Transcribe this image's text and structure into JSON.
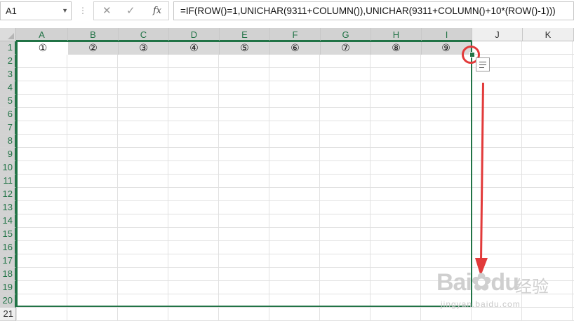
{
  "formula_bar": {
    "name_box": "A1",
    "cancel_glyph": "✕",
    "confirm_glyph": "✓",
    "fx_label": "fx",
    "formula": "=IF(ROW()=1,UNICHAR(9311+COLUMN()),UNICHAR(9311+COLUMN()+10*(ROW()-1)))"
  },
  "columns": [
    "A",
    "B",
    "C",
    "D",
    "E",
    "F",
    "G",
    "H",
    "I",
    "J",
    "K"
  ],
  "rows": [
    "1",
    "2",
    "3",
    "4",
    "5",
    "6",
    "7",
    "8",
    "9",
    "10",
    "11",
    "12",
    "13",
    "14",
    "15",
    "16",
    "17",
    "18",
    "19",
    "20",
    "21"
  ],
  "row1_values": [
    "①",
    "②",
    "③",
    "④",
    "⑤",
    "⑥",
    "⑦",
    "⑧",
    "⑨"
  ],
  "selection": {
    "range": "A1:I20",
    "active_cell": "A1"
  },
  "icons": {
    "name_box_dropdown": "chevron-down-icon",
    "quick_analysis": "quick-analysis-icon",
    "fill_handle": "fill-handle"
  },
  "colors": {
    "selection": "#217346",
    "annotation": "#e23a3a",
    "header_selected": "#d2d2d2"
  },
  "watermark": {
    "brand": "Bai",
    "brand2": "du",
    "cn": "经验",
    "url": "jingyan.baidu.com"
  }
}
